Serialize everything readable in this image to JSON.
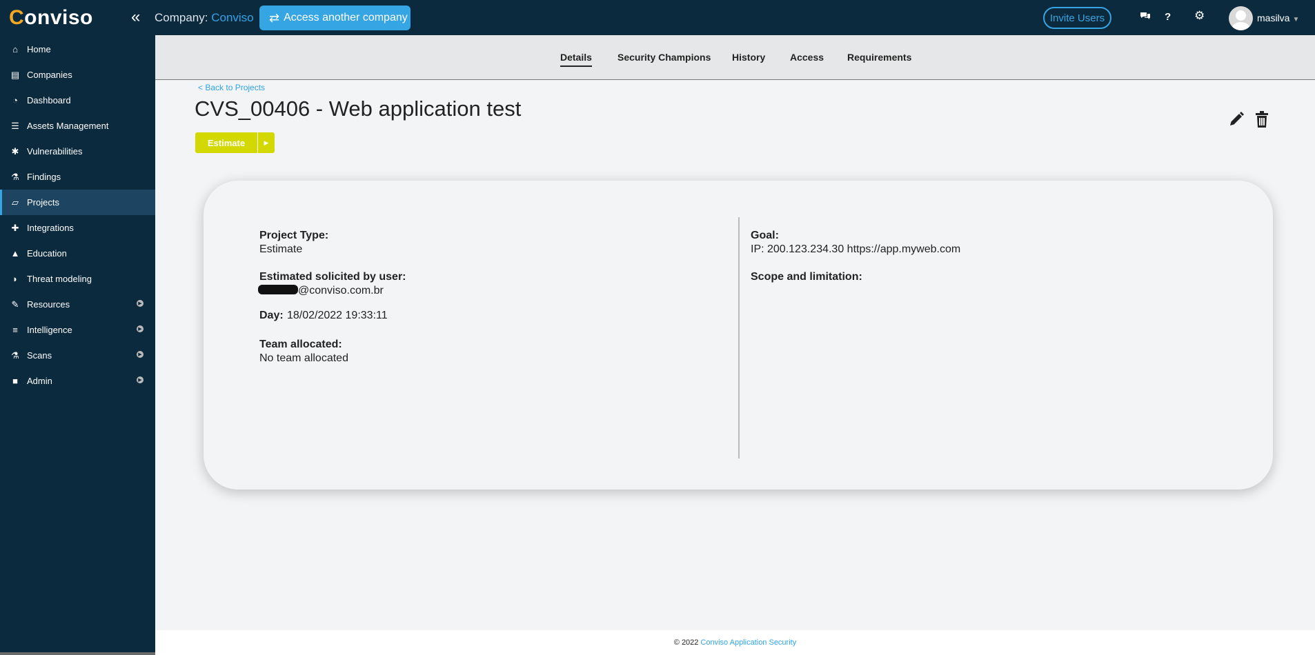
{
  "header": {
    "logo_text": "Conviso",
    "company_label": "Company:",
    "company_name": "Conviso",
    "access_button": "Access another company",
    "invite_button": "Invite Users",
    "username": "masilva",
    "icons": [
      "collapse-icon",
      "chat-icon",
      "help-icon",
      "settings-icon"
    ]
  },
  "sidebar": {
    "items": [
      {
        "label": "Home",
        "icon": "home-icon",
        "glyph": "⌂"
      },
      {
        "label": "Companies",
        "icon": "building-icon",
        "glyph": "▤"
      },
      {
        "label": "Dashboard",
        "icon": "dashboard-icon",
        "glyph": "◔"
      },
      {
        "label": "Assets Management",
        "icon": "server-icon",
        "glyph": "☰"
      },
      {
        "label": "Vulnerabilities",
        "icon": "bug-icon",
        "glyph": "✱"
      },
      {
        "label": "Findings",
        "icon": "flask-icon",
        "glyph": "⚗"
      },
      {
        "label": "Projects",
        "icon": "folder-icon",
        "glyph": "▱",
        "active": true
      },
      {
        "label": "Integrations",
        "icon": "puzzle-icon",
        "glyph": "✚"
      },
      {
        "label": "Education",
        "icon": "graduation-icon",
        "glyph": "▲"
      },
      {
        "label": "Threat modeling",
        "icon": "shield-icon",
        "glyph": "◗"
      },
      {
        "label": "Resources",
        "icon": "wrench-icon",
        "glyph": "✎",
        "expandable": true
      },
      {
        "label": "Intelligence",
        "icon": "database-icon",
        "glyph": "≡",
        "expandable": true
      },
      {
        "label": "Scans",
        "icon": "flask-icon",
        "glyph": "⚗",
        "expandable": true
      },
      {
        "label": "Admin",
        "icon": "briefcase-icon",
        "glyph": "■",
        "expandable": true
      }
    ]
  },
  "tabs": [
    {
      "label": "Details",
      "active": true
    },
    {
      "label": "Security Champions"
    },
    {
      "label": "History"
    },
    {
      "label": "Access"
    },
    {
      "label": "Requirements"
    }
  ],
  "page": {
    "back_link": "< Back to Projects",
    "title": "CVS_00406 - Web application test",
    "status_button": "Estimate"
  },
  "details": {
    "project_type_label": "Project Type:",
    "project_type_value": "Estimate",
    "solicited_label": "Estimated solicited by user:",
    "solicited_value": "@conviso.com.br",
    "day_label": "Day:",
    "day_value": "18/02/2022 19:33:11",
    "team_label": "Team allocated:",
    "team_value": "No team allocated",
    "goal_label": "Goal:",
    "goal_value": "IP: 200.123.234.30 https://app.myweb.com",
    "scope_label": "Scope and limitation:"
  },
  "footer": {
    "copyright": "© 2022",
    "link": "Conviso Application Security"
  },
  "colors": {
    "sidebar_bg": "#0c2a3e",
    "accent_blue": "#36a5e3",
    "estimate_yellow": "#d3d800"
  }
}
